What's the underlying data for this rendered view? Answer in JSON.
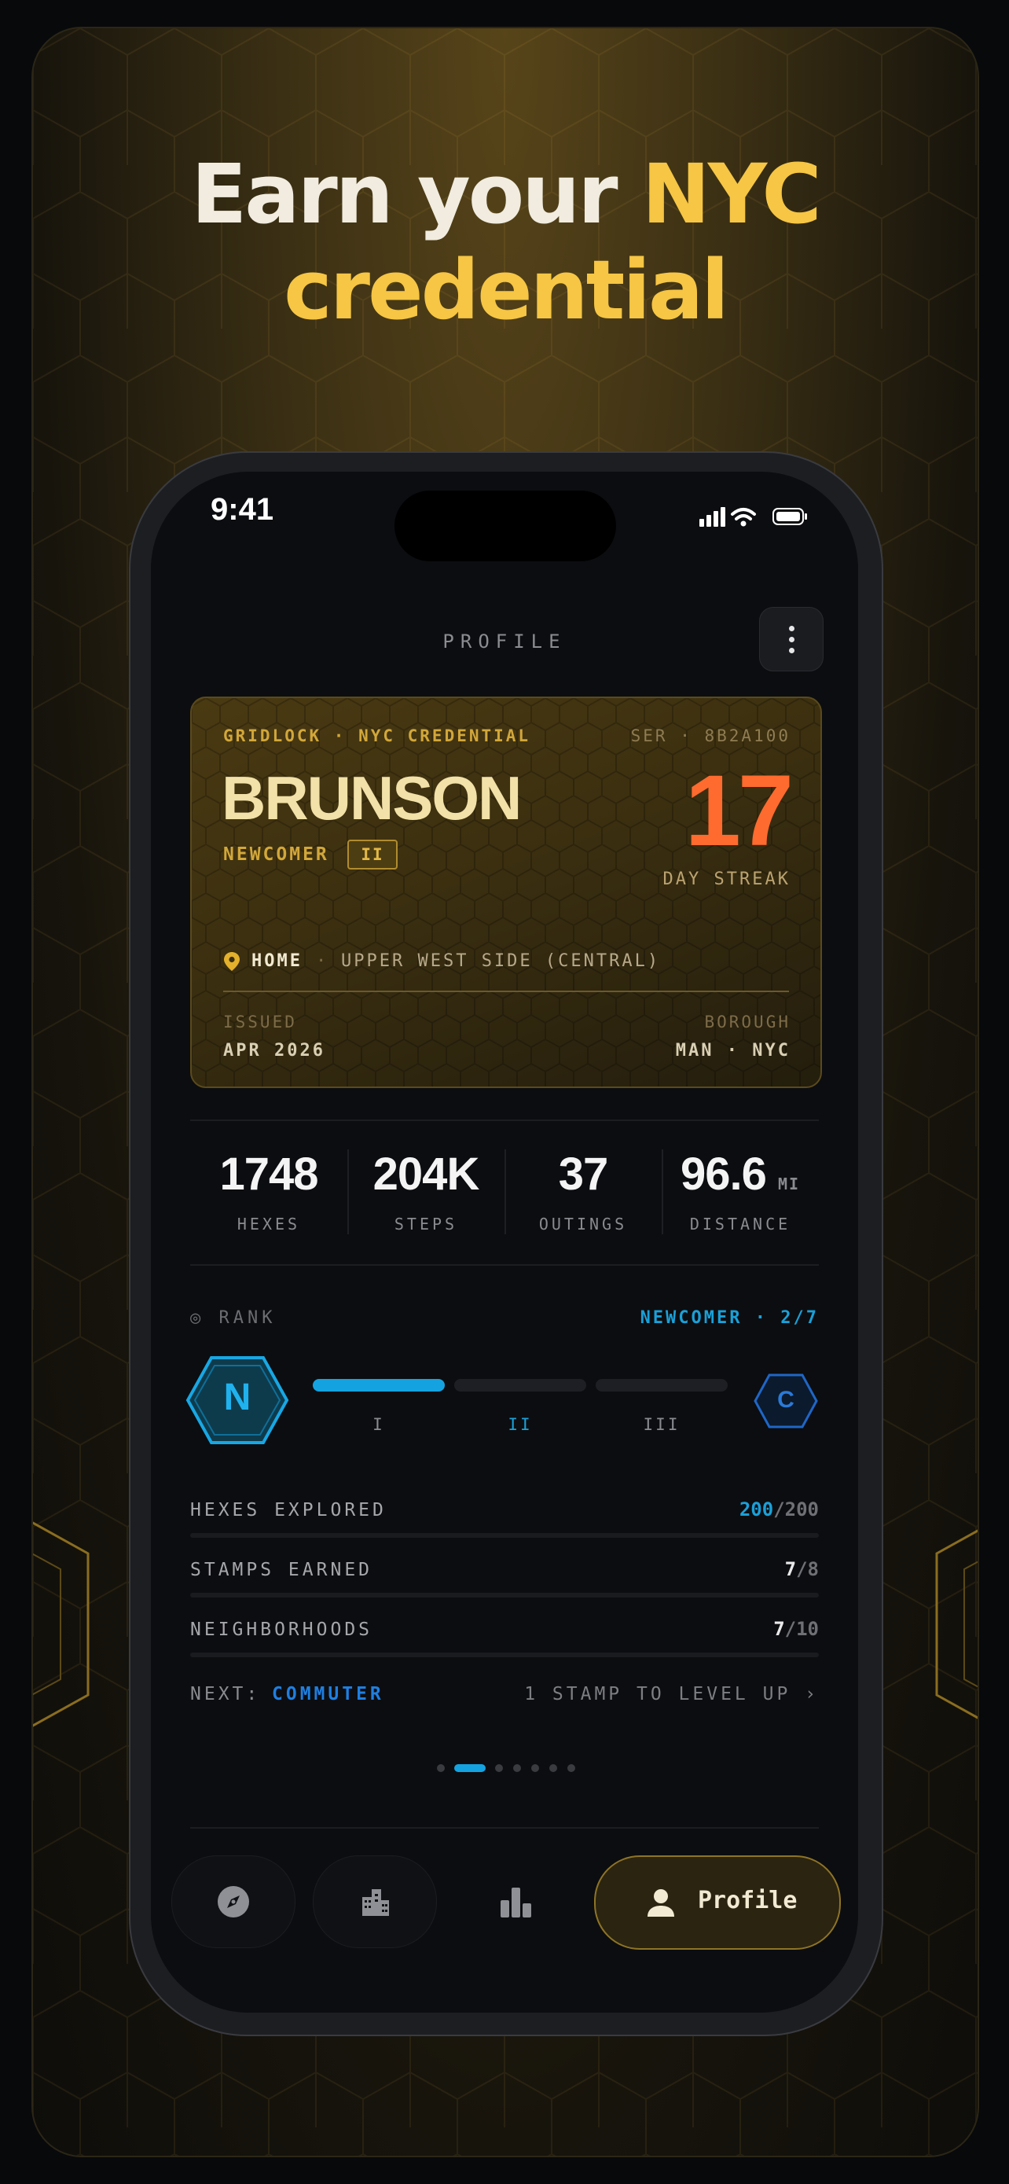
{
  "headline": {
    "line1_plain": "Earn your ",
    "line1_accent": "NYC",
    "line2_accent": "credential"
  },
  "status_bar": {
    "time": "9:41"
  },
  "screen": {
    "title": "PROFILE"
  },
  "card": {
    "brand": "GRIDLOCK · NYC CREDENTIAL",
    "serial": "SER · 8B2A100",
    "name": "BRUNSON",
    "rank": "NEWCOMER",
    "tier": "II",
    "streak_value": "17",
    "streak_label": "DAY STREAK",
    "home_label": "HOME",
    "home_separator": "·",
    "home_value": "UPPER WEST SIDE (CENTRAL)",
    "issued_label": "ISSUED",
    "issued_value": "APR 2026",
    "borough_label": "BOROUGH",
    "borough_value": "MAN · NYC"
  },
  "stats": [
    {
      "value": "1748",
      "unit": "",
      "label": "HEXES"
    },
    {
      "value": "204K",
      "unit": "",
      "label": "STEPS"
    },
    {
      "value": "37",
      "unit": "",
      "label": "OUTINGS"
    },
    {
      "value": "96.6",
      "unit": "MI",
      "label": "DISTANCE"
    }
  ],
  "rank": {
    "label": "◎ RANK",
    "value": "NEWCOMER · 2/7",
    "current_badge": "N",
    "next_badge": "C",
    "tiers": [
      "I",
      "II",
      "III"
    ],
    "tiers_completed": 1,
    "active_tier_index": 1
  },
  "progress_rows": [
    {
      "label": "HEXES EXPLORED",
      "current": "200",
      "total": "/200",
      "fraction": 1.0
    },
    {
      "label": "STAMPS EARNED",
      "current": "7",
      "total": "/8",
      "fraction": 0.875
    },
    {
      "label": "NEIGHBORHOODS",
      "current": "7",
      "total": "/10",
      "fraction": 0.7
    }
  ],
  "next": {
    "label": "NEXT:",
    "value": "COMMUTER",
    "hint": "1 STAMP TO LEVEL UP ›"
  },
  "pager": {
    "count": 8,
    "active_index": 1
  },
  "tabs": [
    {
      "icon": "compass-icon",
      "label": ""
    },
    {
      "icon": "buildings-icon",
      "label": ""
    },
    {
      "icon": "bar-chart-icon",
      "label": ""
    },
    {
      "icon": "person-icon",
      "label": "Profile"
    }
  ],
  "colors": {
    "gold": "#f6c644",
    "streak_orange": "#ff6b2f",
    "rank_blue": "#14a3e0",
    "next_blue": "#1f7fe0"
  }
}
